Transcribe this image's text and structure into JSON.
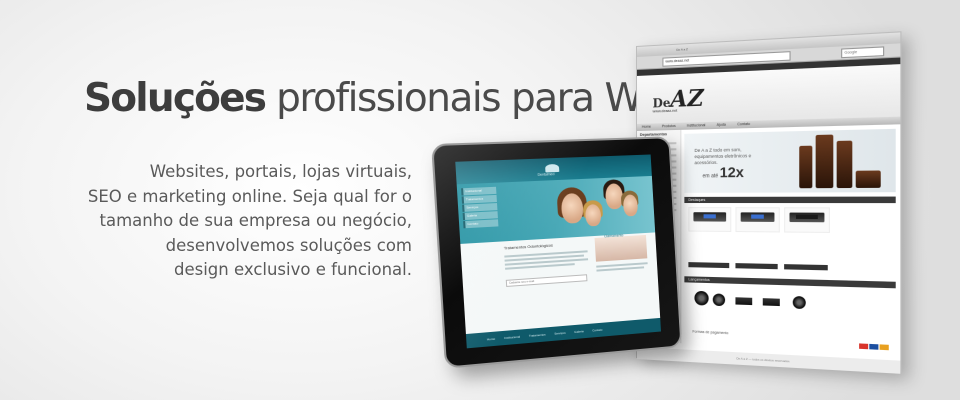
{
  "headline": {
    "strong": "Soluções",
    "rest": " profissionais para WEB"
  },
  "description": [
    "Websites, portais, lojas virtuais,",
    "SEO e marketing online. Seja qual for o",
    "tamanho de sua empresa ou negócio,",
    "desenvolvemos soluções com",
    "design exclusivo e funcional."
  ],
  "browser": {
    "window_title": "De A a Z",
    "url": "www.deaaz.net",
    "search_placeholder": "Google",
    "logo_prefix": "De",
    "logo_az": "AZ",
    "logo_sub": "www.deaaz.net",
    "nav": [
      "Home",
      "Produtos",
      "Institucional",
      "Ajuda",
      "Contato"
    ],
    "sidebar_heading": "Departamentos",
    "promo_text": "De A a Z todo em som, equipamentos eletrônicos e acessórios.",
    "promo_prefix": "em até",
    "promo_installments": "12x",
    "promo_suffix": "nos cartões de crédito",
    "section_1": "Destaques",
    "section_2": "Lançamentos",
    "payment_text": "Formas de pagamento",
    "footer_text": "De A a Z — todos os direitos reservados",
    "colors": {
      "dark_bar": "#333333",
      "speaker_wood": "#6b3a1e"
    }
  },
  "tablet": {
    "site_name": "Dentalmed",
    "menu": [
      "Institucional",
      "Tratamentos",
      "Serviços",
      "Galeria",
      "Contato"
    ],
    "content_title": "Tratamentos Odontológicos",
    "side_title": "Clareamento",
    "newsletter_placeholder": "Cadastre seu e-mail",
    "footer_links": [
      "Home",
      "Institucional",
      "Tratamentos",
      "Serviços",
      "Galeria",
      "Contato"
    ],
    "colors": {
      "teal": "#1a7d8f",
      "teal_dark": "#0f5a6a"
    }
  }
}
